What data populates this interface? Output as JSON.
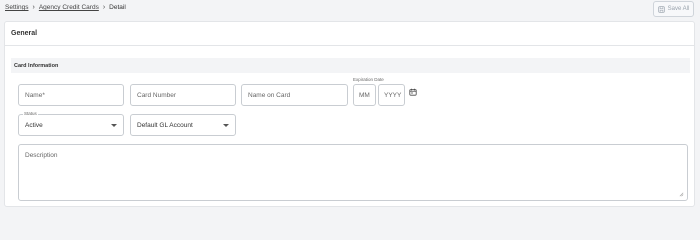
{
  "breadcrumb": {
    "items": [
      "Settings",
      "Agency Credit Cards"
    ],
    "current": "Detail"
  },
  "toolbar": {
    "save_all_label": "Save All"
  },
  "card": {
    "header_title": "General",
    "section_title": "Card Information"
  },
  "form": {
    "name_placeholder": "Name*",
    "card_number_placeholder": "Card Number",
    "name_on_card_placeholder": "Name on Card",
    "expiration_label": "Expiration Date",
    "month_placeholder": "MM",
    "year_placeholder": "YYYY",
    "status_label": "Status",
    "status_value": "Active",
    "gl_account_value": "Default GL Account",
    "description_placeholder": "Description"
  },
  "icons": {
    "save": "save-icon",
    "calendar": "calendar-icon",
    "chevron": "chevron-right-icon",
    "dropdown": "caret-down-icon"
  },
  "colors": {
    "page_bg": "#f3f4f6",
    "card_bg": "#ffffff",
    "border": "#c9cdd2",
    "section_bg": "#f3f4f6"
  }
}
